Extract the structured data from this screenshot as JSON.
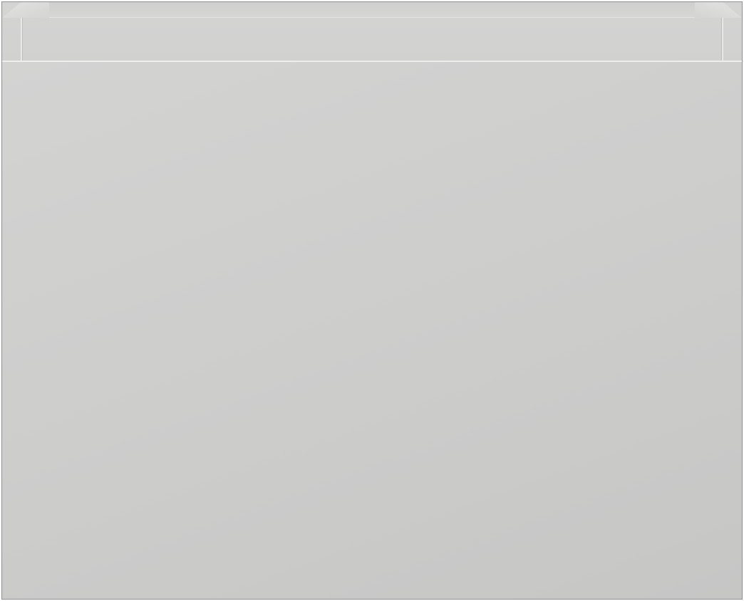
{
  "scene": {
    "subject": "",
    "colors": {
      "panel": "#cdcdcc",
      "panel_light": "#d4d4d3",
      "edge": "#9a9a9a",
      "highlight": "#ececeb"
    }
  }
}
